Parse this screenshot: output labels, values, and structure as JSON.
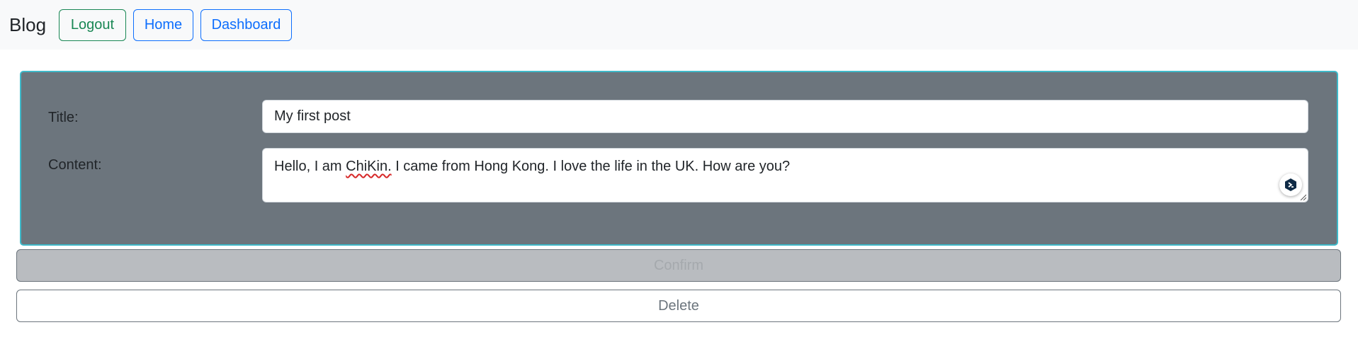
{
  "navbar": {
    "brand": "Blog",
    "logout_label": "Logout",
    "home_label": "Home",
    "dashboard_label": "Dashboard"
  },
  "form": {
    "title_label": "Title:",
    "title_value": "My first post",
    "content_label": "Content:",
    "content_before": "Hello, I am ",
    "content_misspelled": "ChiKin.",
    "content_after": " I came from Hong Kong. I love the life in the UK. How are you?",
    "extension_icon": "translate-extension-icon"
  },
  "actions": {
    "confirm_label": "Confirm",
    "delete_label": "Delete"
  },
  "colors": {
    "panel_bg": "#6c757d",
    "panel_border": "#3fb9c9",
    "logout": "#198754",
    "primary": "#0d6efd",
    "secondary": "#6c757d"
  }
}
